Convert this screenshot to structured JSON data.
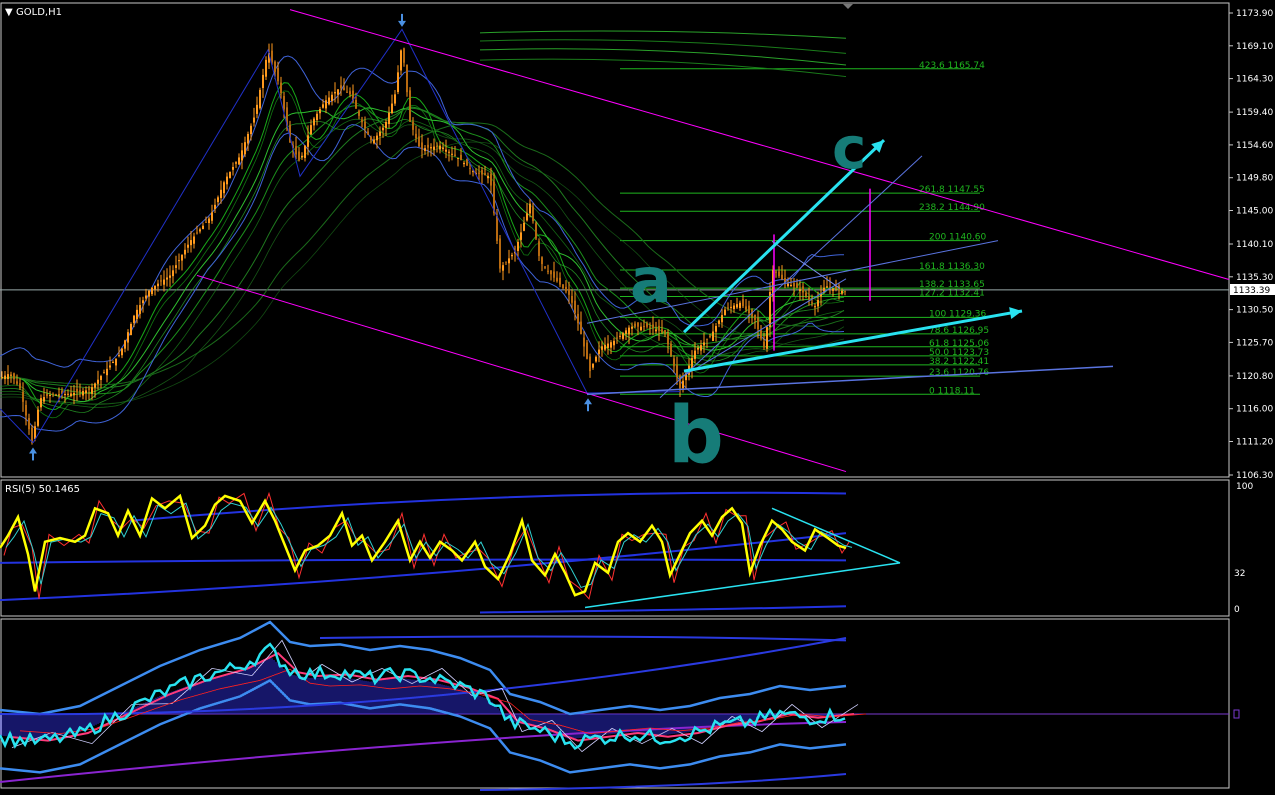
{
  "window": {
    "symbol_label": "GOLD,H1",
    "current_price": "1133.39"
  },
  "colors": {
    "background": "#000000",
    "frame": "#c8c8c8",
    "candle": "#ff9a1e",
    "bands": "#3f63d8",
    "magenta": "#ff00ff",
    "cyan": "#29e2f0",
    "fib": "#1fb61f",
    "yellow": "#ffff00",
    "teal_mark": "#167c78",
    "arrow_marker": "#4a90e2",
    "macd_hist": "#2d2dd0"
  },
  "main_panel": {
    "price_axis_labels": [
      "1173.90",
      "1169.10",
      "1164.30",
      "1159.40",
      "1154.60",
      "1149.80",
      "1145.00",
      "1140.10",
      "1135.30",
      "1130.50",
      "1125.70",
      "1120.80",
      "1116.00",
      "1111.20",
      "1106.30"
    ],
    "hand_labels": [
      "a",
      "c",
      "b"
    ]
  },
  "chart_data": [
    {
      "type": "candlestick",
      "title": "GOLD,H1",
      "ylim": [
        1106.3,
        1173.9
      ],
      "approx_close_path": [
        [
          0,
          1120.5
        ],
        [
          10,
          1121.2
        ],
        [
          20,
          1119.0
        ],
        [
          32,
          1111.0
        ],
        [
          40,
          1117.5
        ],
        [
          50,
          1118.0
        ],
        [
          70,
          1118.2
        ],
        [
          90,
          1118.8
        ],
        [
          105,
          1121.5
        ],
        [
          120,
          1124.0
        ],
        [
          135,
          1130.0
        ],
        [
          150,
          1133.5
        ],
        [
          170,
          1135.5
        ],
        [
          190,
          1140.5
        ],
        [
          210,
          1144.0
        ],
        [
          225,
          1149.5
        ],
        [
          240,
          1153.0
        ],
        [
          255,
          1159.0
        ],
        [
          268,
          1168.5
        ],
        [
          280,
          1163.0
        ],
        [
          290,
          1155.0
        ],
        [
          300,
          1152.0
        ],
        [
          312,
          1158.0
        ],
        [
          325,
          1161.0
        ],
        [
          340,
          1163.0
        ],
        [
          350,
          1162.0
        ],
        [
          360,
          1158.5
        ],
        [
          372,
          1155.0
        ],
        [
          385,
          1157.5
        ],
        [
          395,
          1162.0
        ],
        [
          402,
          1169.5
        ],
        [
          410,
          1158.0
        ],
        [
          420,
          1154.0
        ],
        [
          440,
          1154.5
        ],
        [
          460,
          1152.5
        ],
        [
          475,
          1150.5
        ],
        [
          490,
          1150.0
        ],
        [
          500,
          1136.5
        ],
        [
          515,
          1139.0
        ],
        [
          530,
          1146.0
        ],
        [
          540,
          1137.5
        ],
        [
          555,
          1135.0
        ],
        [
          570,
          1132.5
        ],
        [
          580,
          1127.5
        ],
        [
          590,
          1121.5
        ],
        [
          600,
          1125.0
        ],
        [
          615,
          1126.0
        ],
        [
          630,
          1128.0
        ],
        [
          650,
          1128.0
        ],
        [
          665,
          1127.0
        ],
        [
          680,
          1119.0
        ],
        [
          695,
          1124.5
        ],
        [
          710,
          1126.5
        ],
        [
          725,
          1130.5
        ],
        [
          740,
          1131.5
        ],
        [
          755,
          1129.0
        ],
        [
          765,
          1124.5
        ],
        [
          772,
          1136.5
        ],
        [
          785,
          1134.5
        ],
        [
          800,
          1133.5
        ],
        [
          815,
          1131.0
        ],
        [
          825,
          1134.0
        ],
        [
          835,
          1133.5
        ],
        [
          848,
          1133.0
        ]
      ],
      "fibonacci_levels": [
        {
          "label": "423.6 1165.74",
          "price": 1165.74
        },
        {
          "label": "261.8 1147.55",
          "price": 1147.55
        },
        {
          "label": "238.2 1144.90",
          "price": 1144.9
        },
        {
          "label": "200 1140.60",
          "price": 1140.6
        },
        {
          "label": "161.8 1136.30",
          "price": 1136.3
        },
        {
          "label": "138.2 1133.65",
          "price": 1133.65
        },
        {
          "label": "127.2 1132.41",
          "price": 1132.41
        },
        {
          "label": "100 1129.36",
          "price": 1129.36
        },
        {
          "label": "78.6 1126.95",
          "price": 1126.95
        },
        {
          "label": "61.8 1125.06",
          "price": 1125.06
        },
        {
          "label": "50.0 1123.73",
          "price": 1123.73
        },
        {
          "label": "38.2 1122.41",
          "price": 1122.41
        },
        {
          "label": "23.6 1120.76",
          "price": 1120.76
        },
        {
          "label": "0 1118.11",
          "price": 1118.11
        }
      ]
    },
    {
      "type": "line",
      "title": "RSI(5) 50.1465",
      "ylim": [
        0,
        100
      ],
      "tick_labels": [
        "100",
        "32",
        "0"
      ],
      "approx_values": [
        [
          0,
          50
        ],
        [
          8,
          60
        ],
        [
          18,
          75
        ],
        [
          28,
          45
        ],
        [
          35,
          15
        ],
        [
          45,
          55
        ],
        [
          60,
          58
        ],
        [
          75,
          55
        ],
        [
          85,
          60
        ],
        [
          95,
          82
        ],
        [
          108,
          78
        ],
        [
          118,
          60
        ],
        [
          128,
          80
        ],
        [
          140,
          60
        ],
        [
          152,
          90
        ],
        [
          165,
          82
        ],
        [
          180,
          92
        ],
        [
          192,
          58
        ],
        [
          205,
          68
        ],
        [
          215,
          85
        ],
        [
          225,
          92
        ],
        [
          240,
          88
        ],
        [
          252,
          70
        ],
        [
          265,
          88
        ],
        [
          275,
          72
        ],
        [
          285,
          52
        ],
        [
          295,
          32
        ],
        [
          305,
          48
        ],
        [
          318,
          52
        ],
        [
          330,
          60
        ],
        [
          342,
          78
        ],
        [
          352,
          52
        ],
        [
          362,
          60
        ],
        [
          372,
          40
        ],
        [
          385,
          55
        ],
        [
          398,
          72
        ],
        [
          410,
          40
        ],
        [
          420,
          55
        ],
        [
          430,
          42
        ],
        [
          440,
          55
        ],
        [
          452,
          48
        ],
        [
          462,
          40
        ],
        [
          475,
          55
        ],
        [
          485,
          35
        ],
        [
          498,
          25
        ],
        [
          510,
          45
        ],
        [
          522,
          72
        ],
        [
          532,
          40
        ],
        [
          545,
          28
        ],
        [
          555,
          45
        ],
        [
          565,
          30
        ],
        [
          575,
          12
        ],
        [
          585,
          15
        ],
        [
          595,
          38
        ],
        [
          608,
          30
        ],
        [
          618,
          55
        ],
        [
          628,
          62
        ],
        [
          640,
          55
        ],
        [
          652,
          68
        ],
        [
          662,
          55
        ],
        [
          670,
          28
        ],
        [
          680,
          45
        ],
        [
          690,
          62
        ],
        [
          702,
          72
        ],
        [
          712,
          60
        ],
        [
          722,
          75
        ],
        [
          732,
          82
        ],
        [
          742,
          70
        ],
        [
          750,
          30
        ],
        [
          760,
          52
        ],
        [
          772,
          72
        ],
        [
          782,
          65
        ],
        [
          792,
          55
        ],
        [
          805,
          48
        ],
        [
          815,
          65
        ],
        [
          828,
          58
        ],
        [
          838,
          52
        ],
        [
          846,
          50
        ]
      ],
      "triangle_apex_x": 900
    },
    {
      "type": "line",
      "title": "",
      "ylim": [
        -1,
        1
      ],
      "approx_values": [
        [
          0,
          -0.3
        ],
        [
          40,
          -0.35
        ],
        [
          80,
          -0.25
        ],
        [
          120,
          0.0
        ],
        [
          160,
          0.25
        ],
        [
          200,
          0.45
        ],
        [
          240,
          0.6
        ],
        [
          270,
          0.8
        ],
        [
          290,
          0.55
        ],
        [
          310,
          0.5
        ],
        [
          340,
          0.52
        ],
        [
          370,
          0.45
        ],
        [
          400,
          0.5
        ],
        [
          430,
          0.45
        ],
        [
          460,
          0.35
        ],
        [
          490,
          0.2
        ],
        [
          510,
          -0.1
        ],
        [
          540,
          -0.2
        ],
        [
          570,
          -0.35
        ],
        [
          600,
          -0.3
        ],
        [
          630,
          -0.25
        ],
        [
          660,
          -0.3
        ],
        [
          690,
          -0.25
        ],
        [
          720,
          -0.15
        ],
        [
          750,
          -0.1
        ],
        [
          780,
          0.0
        ],
        [
          810,
          -0.05
        ],
        [
          846,
          0.0
        ]
      ]
    }
  ]
}
